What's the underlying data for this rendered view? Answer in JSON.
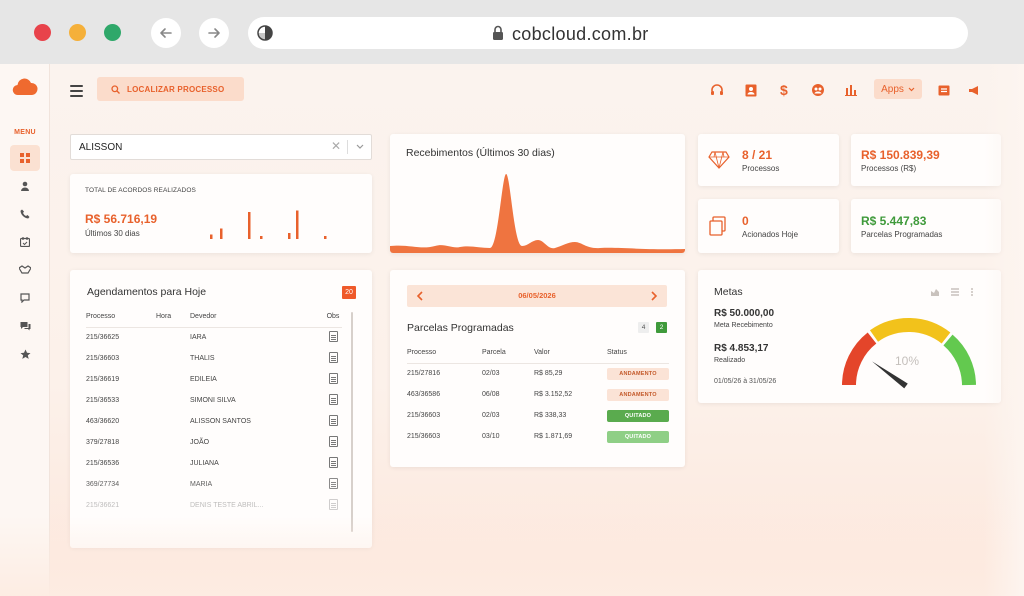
{
  "browser": {
    "url": "cobcloud.com.br"
  },
  "sidebar": {
    "menu_label": "MENU",
    "items": [
      {
        "icon": "dashboard-icon"
      },
      {
        "icon": "user-icon"
      },
      {
        "icon": "phone-icon"
      },
      {
        "icon": "calendar-icon"
      },
      {
        "icon": "handshake-icon"
      },
      {
        "icon": "chat-icon"
      },
      {
        "icon": "chat-bubbles-icon"
      },
      {
        "icon": "star-icon"
      }
    ]
  },
  "topbar": {
    "search_label": "LOCALIZAR PROCESSO",
    "apps_label": "Apps"
  },
  "filter": {
    "value": "ALISSON"
  },
  "acordos": {
    "title": "TOTAL DE ACORDOS REALIZADOS",
    "value": "R$ 56.716,19",
    "subtitle": "Últimos 30 dias",
    "bars": [
      0.15,
      0.35,
      0.9,
      0.1,
      0.2,
      0.95,
      0.1
    ]
  },
  "recebimentos": {
    "title": "Recebimentos (Últimos 30 dias)"
  },
  "stats": {
    "processos_count": "8 / 21",
    "processos_label": "Processos",
    "processos_value": "R$ 150.839,39",
    "processos_value_label": "Processos (R$)",
    "acionados_count": "0",
    "acionados_label": "Acionados Hoje",
    "parcelas_value": "R$ 5.447,83",
    "parcelas_value_label": "Parcelas Programadas"
  },
  "agendamentos": {
    "title": "Agendamentos para Hoje",
    "badge": "20",
    "headers": [
      "Processo",
      "Hora",
      "Devedor",
      "Obs"
    ],
    "rows": [
      {
        "processo": "215/36625",
        "hora": "",
        "devedor": "IARA"
      },
      {
        "processo": "215/36603",
        "hora": "",
        "devedor": "THALIS"
      },
      {
        "processo": "215/36619",
        "hora": "",
        "devedor": "EDILEIA"
      },
      {
        "processo": "215/36533",
        "hora": "",
        "devedor": "SIMONI SILVA"
      },
      {
        "processo": "463/36620",
        "hora": "",
        "devedor": "ALISSON SANTOS"
      },
      {
        "processo": "379/27818",
        "hora": "",
        "devedor": "JOÃO"
      },
      {
        "processo": "215/36536",
        "hora": "",
        "devedor": "JULIANA"
      },
      {
        "processo": "369/27734",
        "hora": "",
        "devedor": "MARIA"
      },
      {
        "processo": "215/36621",
        "hora": "",
        "devedor": "DENIS TESTE ABRIL..."
      }
    ]
  },
  "parcelas": {
    "date": "06/05/2026",
    "title": "Parcelas Programadas",
    "count_a": "4",
    "count_b": "2",
    "headers": [
      "Processo",
      "Parcela",
      "Valor",
      "Status"
    ],
    "rows": [
      {
        "processo": "215/27816",
        "parcela": "02/03",
        "valor": "R$ 85,29",
        "status": "ANDAMENTO",
        "kind": "and"
      },
      {
        "processo": "463/36586",
        "parcela": "06/08",
        "valor": "R$ 3.152,52",
        "status": "ANDAMENTO",
        "kind": "and"
      },
      {
        "processo": "215/36603",
        "parcela": "02/03",
        "valor": "R$ 338,33",
        "status": "QUITADO",
        "kind": "quit"
      },
      {
        "processo": "215/36603",
        "parcela": "03/10",
        "valor": "R$ 1.871,69",
        "status": "QUITADO",
        "kind": "quit2"
      }
    ]
  },
  "metas": {
    "title": "Metas",
    "meta_value": "R$ 50.000,00",
    "meta_label": "Meta Recebimento",
    "realizado_value": "R$ 4.853,17",
    "realizado_label": "Realizado",
    "period": "01/05/26 à 31/05/26",
    "gauge_text": "10%",
    "gauge_fraction": 0.1
  },
  "colors": {
    "accent": "#e8612c",
    "green": "#3f9a3b"
  }
}
